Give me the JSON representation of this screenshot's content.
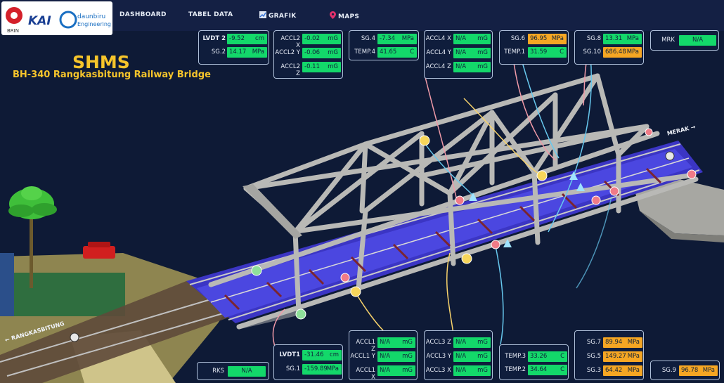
{
  "nav": {
    "logos": {
      "brin": "BRIN",
      "kai": "KAI",
      "daunbiru": "daunbiru",
      "engineering": "Engineering"
    },
    "items": [
      {
        "label": "DASHBOARD",
        "icon": ""
      },
      {
        "label": "TABEL DATA",
        "icon": ""
      },
      {
        "label": "GRAFIK",
        "icon": "chart-icon"
      },
      {
        "label": "MAPS",
        "icon": "map-pin-icon"
      }
    ]
  },
  "header": {
    "title": "SHMS",
    "subtitle": "BH-340 Rangkasbitung Railway Bridge"
  },
  "scene": {
    "left_direction": "← RANGKASBITUNG",
    "right_direction": "MERAK →"
  },
  "colors": {
    "ok": "#13d86a",
    "warn": "#f5a623",
    "background": "#0e1a36",
    "accent": "#f7c52b"
  },
  "sensors": {
    "lvdt2": {
      "label": "LVDT 2",
      "value": "-9.52",
      "unit": "cm",
      "status": "ok"
    },
    "sg2": {
      "label": "SG.2",
      "value": "14.17",
      "unit": "MPa",
      "status": "ok"
    },
    "accl2x": {
      "label": "ACCL2 X",
      "value": "-0.02",
      "unit": "mG",
      "status": "ok"
    },
    "accl2y": {
      "label": "ACCL2 Y",
      "value": "-0.06",
      "unit": "mG",
      "status": "ok"
    },
    "accl2z": {
      "label": "ACCL2 Z",
      "value": "-0.11",
      "unit": "mG",
      "status": "ok"
    },
    "sg4": {
      "label": "SG.4",
      "value": "-7.34",
      "unit": "MPa",
      "status": "ok"
    },
    "temp4": {
      "label": "TEMP.4",
      "value": "41.65",
      "unit": "C",
      "status": "ok"
    },
    "accl4x": {
      "label": "ACCL4 X",
      "value": "N/A",
      "unit": "mG",
      "status": "ok"
    },
    "accl4y": {
      "label": "ACCL4 Y",
      "value": "N/A",
      "unit": "mG",
      "status": "ok"
    },
    "accl4z": {
      "label": "ACCL4 Z",
      "value": "N/A",
      "unit": "mG",
      "status": "ok"
    },
    "sg6": {
      "label": "SG.6",
      "value": "96.95",
      "unit": "MPa",
      "status": "warn"
    },
    "temp1": {
      "label": "TEMP.1",
      "value": "31.59",
      "unit": "C",
      "status": "ok"
    },
    "sg8": {
      "label": "SG.8",
      "value": "13.31",
      "unit": "MPa",
      "status": "ok"
    },
    "sg10": {
      "label": "SG.10",
      "value": "686.48",
      "unit": "MPa",
      "status": "warn"
    },
    "mrk": {
      "label": "MRK",
      "value": "N/A",
      "unit": "",
      "status": "ok"
    },
    "rks": {
      "label": "RKS",
      "value": "N/A",
      "unit": "",
      "status": "ok"
    },
    "lvdt1": {
      "label": "LVDT1",
      "value": "-31.46",
      "unit": "cm",
      "status": "ok"
    },
    "sg1": {
      "label": "SG.1",
      "value": "-159.89",
      "unit": "MPa",
      "status": "ok"
    },
    "accl1z": {
      "label": "ACCL1 Z",
      "value": "N/A",
      "unit": "mG",
      "status": "ok"
    },
    "accl1y": {
      "label": "ACCL1 Y",
      "value": "N/A",
      "unit": "mG",
      "status": "ok"
    },
    "accl1x": {
      "label": "ACCL1 X",
      "value": "N/A",
      "unit": "mG",
      "status": "ok"
    },
    "accl3z": {
      "label": "ACCL3 Z",
      "value": "N/A",
      "unit": "mG",
      "status": "ok"
    },
    "accl3y": {
      "label": "ACCL3 Y",
      "value": "N/A",
      "unit": "mG",
      "status": "ok"
    },
    "accl3x": {
      "label": "ACCL3 X",
      "value": "N/A",
      "unit": "mG",
      "status": "ok"
    },
    "temp3": {
      "label": "TEMP.3",
      "value": "33.26",
      "unit": "C",
      "status": "ok"
    },
    "temp2": {
      "label": "TEMP.2",
      "value": "34.64",
      "unit": "C",
      "status": "ok"
    },
    "sg7": {
      "label": "SG.7",
      "value": "89.94",
      "unit": "MPa",
      "status": "warn"
    },
    "sg5": {
      "label": "SG.5",
      "value": "149.27",
      "unit": "MPa",
      "status": "warn"
    },
    "sg3": {
      "label": "SG.3",
      "value": "64.42",
      "unit": "MPa",
      "status": "warn"
    },
    "sg9": {
      "label": "SG.9",
      "value": "96.78",
      "unit": "MPa",
      "status": "warn"
    }
  }
}
